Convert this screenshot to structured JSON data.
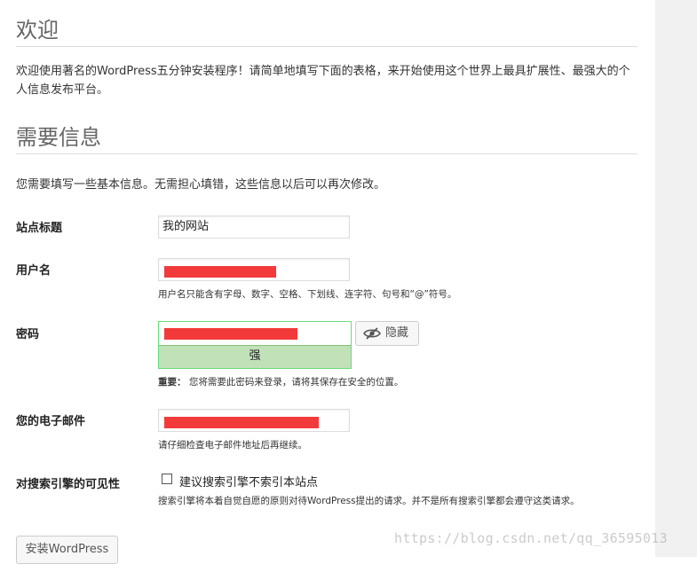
{
  "welcome": {
    "title": "欢迎",
    "intro": "欢迎使用著名的WordPress五分钟安装程序！请简单地填写下面的表格，来开始使用这个世界上最具扩展性、最强大的个人信息发布平台。"
  },
  "info": {
    "title": "需要信息",
    "description": "您需要填写一些基本信息。无需担心填错，这些信息以后可以再次修改。"
  },
  "fields": {
    "site_title": {
      "label": "站点标题",
      "value": "我的网站"
    },
    "username": {
      "label": "用户名",
      "hint": "用户名只能含有字母、数字、空格、下划线、连字符、句号和“@”符号。"
    },
    "password": {
      "label": "密码",
      "strength": "强",
      "hide_label": "隐藏",
      "note_strong": "重要：",
      "note": "您将需要此密码来登录，请将其保存在安全的位置。"
    },
    "email": {
      "label": "您的电子邮件",
      "hint": "请仔细检查电子邮件地址后再继续。"
    },
    "visibility": {
      "label": "对搜索引擎的可见性",
      "checkbox_label": "建议搜索引擎不索引本站点",
      "checked": false,
      "hint": "搜索引擎将本着自觉自愿的原则对待WordPress提出的请求。并不是所有搜索引擎都会遵守这类请求。"
    }
  },
  "install_button": "安装WordPress",
  "watermark": "https://blog.csdn.net/qq_36595013",
  "icons": {
    "eye": "eye-slash-icon"
  }
}
